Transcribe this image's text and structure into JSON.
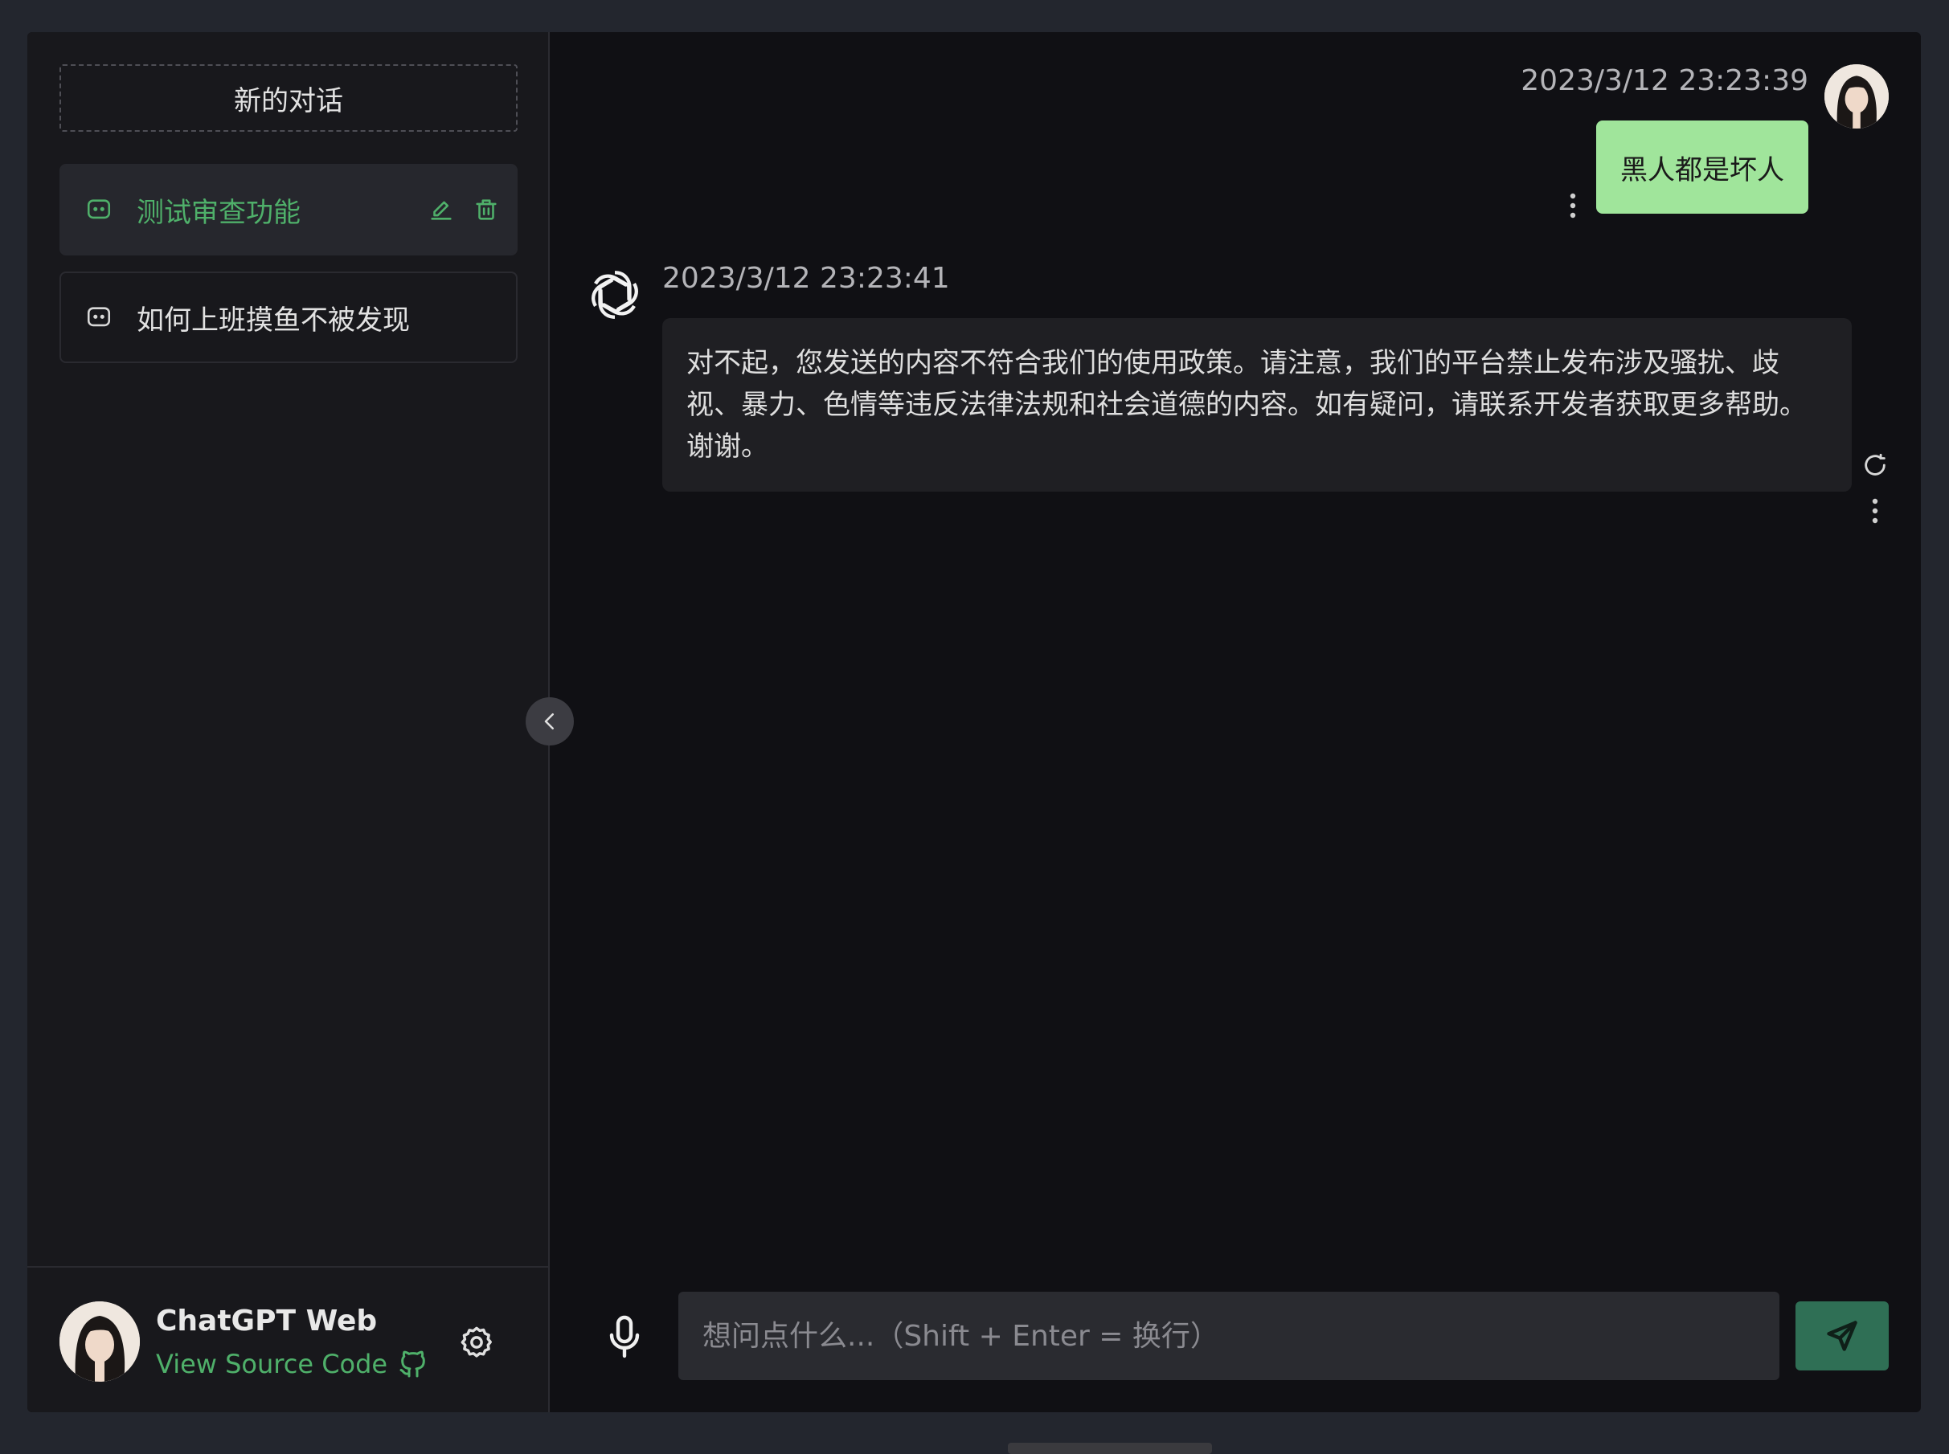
{
  "sidebar": {
    "new_chat_label": "新的对话",
    "history": [
      {
        "title": "测试审查功能",
        "active": true
      },
      {
        "title": "如何上班摸鱼不被发现",
        "active": false
      }
    ],
    "footer": {
      "user_name": "ChatGPT Web",
      "source_link": "View Source Code"
    }
  },
  "chat": {
    "messages": [
      {
        "role": "user",
        "time": "2023/3/12 23:23:39",
        "text": "黑人都是坏人"
      },
      {
        "role": "assistant",
        "time": "2023/3/12 23:23:41",
        "text": "对不起，您发送的内容不符合我们的使用政策。请注意，我们的平台禁止发布涉及骚扰、歧视、暴力、色情等违反法律法规和社会道德的内容。如有疑问，请联系开发者获取更多帮助。谢谢。"
      }
    ]
  },
  "input": {
    "placeholder": "想问点什么...（Shift + Enter = 换行）",
    "value": ""
  },
  "colors": {
    "accent": "#4fb06a",
    "user_bubble": "#a0e59b",
    "send_button": "#2f6f55"
  },
  "icons": {
    "chat": "chat-bubble-icon",
    "edit": "pencil-icon",
    "delete": "trash-icon",
    "settings": "gear-icon",
    "github": "github-icon",
    "collapse": "chevron-left-icon",
    "more": "more-vertical-icon",
    "regenerate": "refresh-icon",
    "microphone": "microphone-icon",
    "send": "send-icon",
    "bot": "openai-logo-icon"
  }
}
